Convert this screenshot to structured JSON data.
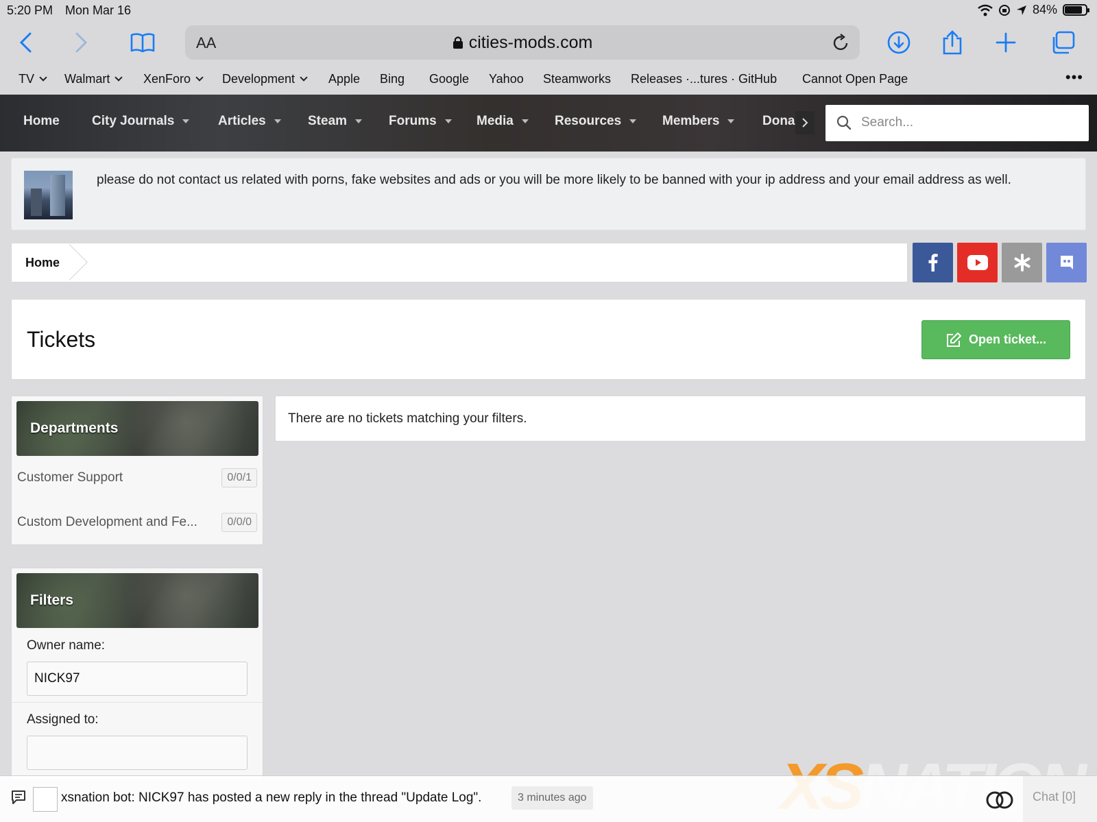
{
  "status_bar": {
    "time": "5:20 PM",
    "date": "Mon Mar 16",
    "battery": "84%",
    "battery_level": 0.84
  },
  "browser": {
    "url": "cities-mods.com",
    "reader_label": "AA",
    "bookmarks": [
      {
        "label": "TV",
        "has_menu": true
      },
      {
        "label": "Walmart",
        "has_menu": true
      },
      {
        "label": "XenForo",
        "has_menu": true
      },
      {
        "label": "Development",
        "has_menu": true
      },
      {
        "label": "Apple",
        "has_menu": false
      },
      {
        "label": "Bing",
        "has_menu": false
      },
      {
        "label": "Google",
        "has_menu": false
      },
      {
        "label": "Yahoo",
        "has_menu": false
      },
      {
        "label": "Steamworks",
        "has_menu": false
      },
      {
        "label": "Releases ·...tures · GitHub",
        "has_menu": false
      },
      {
        "label": "Cannot Open Page",
        "has_menu": false
      }
    ],
    "more_label": "•••"
  },
  "site_nav": {
    "items": [
      {
        "label": "Home"
      },
      {
        "label": "City Journals"
      },
      {
        "label": "Articles"
      },
      {
        "label": "Steam"
      },
      {
        "label": "Forums"
      },
      {
        "label": "Media"
      },
      {
        "label": "Resources"
      },
      {
        "label": "Members"
      },
      {
        "label": "Dona"
      }
    ],
    "search_placeholder": "Search..."
  },
  "notice": {
    "text": "please do not contact us related with porns, fake websites and ads or you will be more likely to be banned with your ip address and your email address as well."
  },
  "breadcrumb": {
    "home": "Home"
  },
  "social": [
    {
      "name": "facebook",
      "color": "#3b5998"
    },
    {
      "name": "youtube",
      "color": "#e52d27"
    },
    {
      "name": "asterisk",
      "color": "#9a9a9a"
    },
    {
      "name": "discord",
      "color": "#7289da"
    }
  ],
  "tickets": {
    "title": "Tickets",
    "open_ticket_label": "Open ticket...",
    "empty_message": "There are no tickets matching your filters."
  },
  "departments": {
    "title": "Departments",
    "items": [
      {
        "label": "Customer Support",
        "count": "0/0/1"
      },
      {
        "label": "Custom Development and Fe...",
        "count": "0/0/0"
      }
    ]
  },
  "filters": {
    "title": "Filters",
    "owner_label": "Owner name:",
    "owner_value": "NICK97",
    "assigned_label": "Assigned to:",
    "assigned_value": ""
  },
  "watermark": {
    "xs": "XS",
    "nation": "NATION"
  },
  "chat": {
    "message": "xsnation bot: NICK97 has posted a new reply in the thread \"Update Log\".",
    "time": "3 minutes ago",
    "label": "Chat [0]"
  },
  "colors": {
    "accent_blue": "#1a7cf5",
    "open_ticket_green": "#58b95d",
    "watermark_orange": "#f39a2b"
  }
}
